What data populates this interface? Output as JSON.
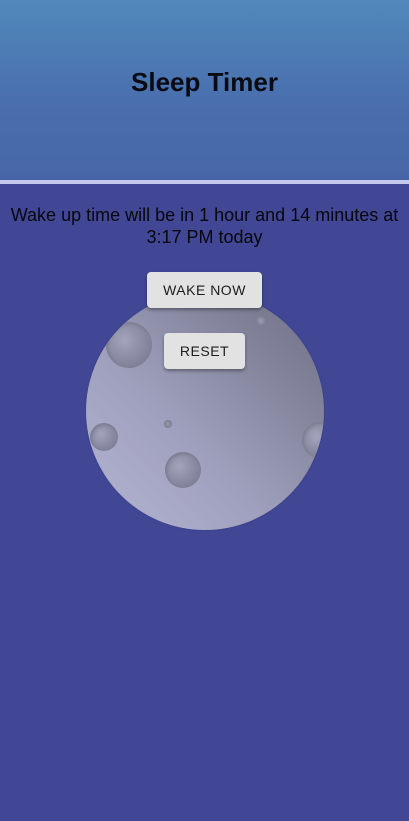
{
  "header": {
    "title": "Sleep Timer"
  },
  "status": {
    "message": "Wake up time will be in 1 hour and 14 minutes at 3:17 PM today"
  },
  "actions": {
    "wake_now_label": "WAKE NOW",
    "reset_label": "RESET"
  },
  "colors": {
    "background": "#414794",
    "header_top": "#5089bb",
    "header_bottom": "#4766a8",
    "divider": "#c3c8ec",
    "button": "#e2e2e2"
  }
}
